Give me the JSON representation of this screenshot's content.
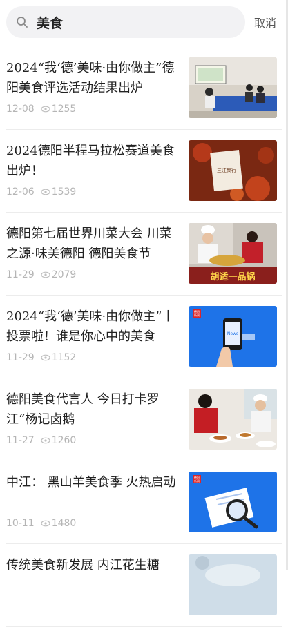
{
  "search": {
    "value": "美食"
  },
  "cancel_label": "取消",
  "articles": [
    {
      "title": "2024“我‘德’美味·由你做主”德阳美食评选活动结果出炉",
      "date": "12-08",
      "views": "1255"
    },
    {
      "title": "2024德阳半程马拉松赛道美食出炉！",
      "date": "12-06",
      "views": "1539"
    },
    {
      "title": "德阳第七届世界川菜大会 川菜之源·味美德阳 德阳美食节",
      "date": "11-29",
      "views": "2079"
    },
    {
      "title": "2024“我‘德’美味·由你做主”丨投票啦！谁是你心中的美食",
      "date": "11-29",
      "views": "1152"
    },
    {
      "title": "德阳美食代言人 今日打卡罗江“杨记卤鹅",
      "date": "11-27",
      "views": "1260"
    },
    {
      "title": "中江： 黑山羊美食季 火热启动",
      "date": "10-11",
      "views": "1480"
    },
    {
      "title": "传统美食新发展 内江花生糖",
      "date": "",
      "views": ""
    }
  ],
  "thumb_text": {
    "dish_label": "胡适一品锅",
    "logo_line1": "德阳",
    "logo_line2": "新闻",
    "phone_label": "News",
    "box_label": "三江聚行"
  },
  "colors": {
    "blue": "#1e73e8",
    "logo_red": "#d9262b"
  }
}
